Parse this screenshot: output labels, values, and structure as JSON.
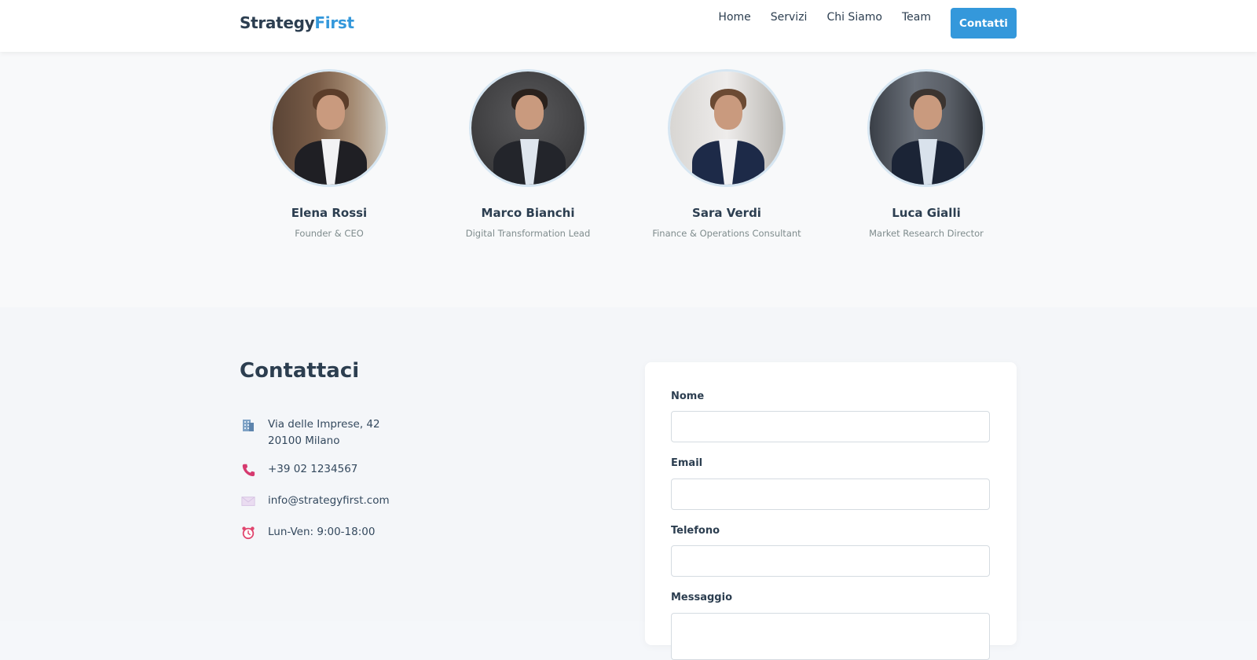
{
  "brand": {
    "part1": "Strategy",
    "part2": "First"
  },
  "nav": {
    "links": [
      "Home",
      "Servizi",
      "Chi Siamo",
      "Team"
    ],
    "cta": "Contatti"
  },
  "team": [
    {
      "name": "Elena Rossi",
      "role": "Founder & CEO"
    },
    {
      "name": "Marco Bianchi",
      "role": "Digital Transformation Lead"
    },
    {
      "name": "Sara Verdi",
      "role": "Finance & Operations Consultant"
    },
    {
      "name": "Luca Gialli",
      "role": "Market Research Director"
    }
  ],
  "contact": {
    "title": "Contattaci",
    "address_line1": "Via delle Imprese, 42",
    "address_line2": "20100 Milano",
    "phone": "+39 02 1234567",
    "email": "info@strategyfirst.com",
    "hours": "Lun-Ven: 9:00-18:00",
    "icons": [
      "building-icon",
      "phone-icon",
      "envelope-icon",
      "alarm-clock-icon"
    ]
  },
  "form": {
    "name_label": "Nome",
    "email_label": "Email",
    "phone_label": "Telefono",
    "message_label": "Messaggio",
    "name_value": "",
    "email_value": "",
    "phone_value": ""
  },
  "colors": {
    "accent": "#3498db",
    "text": "#2c3e50",
    "muted": "#7f8c8d"
  }
}
